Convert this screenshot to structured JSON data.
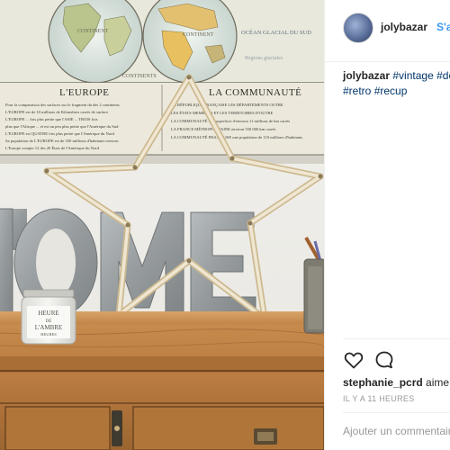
{
  "post": {
    "username": "jolybazar",
    "follow_label": "S'abonner",
    "caption_user": "jolybazar",
    "hashtags": [
      "#vintage",
      "#deco",
      "#retro",
      "#recup"
    ],
    "liker": "stephanie_pcrd",
    "likes_suffix": "aime",
    "timestamp": "IL Y A 11 HEURES",
    "comment_placeholder": "Ajouter un commentaire..."
  },
  "photo": {
    "map_labels": {
      "continent": "CONTINENT",
      "continents": "CONTINENTS",
      "ocean": "OCÉAN GLACIAL DU SUD",
      "regions": "Régions glaciales"
    },
    "poster_left_title": "L'EUROPE",
    "poster_right_title": "LA COMMUNAUTÉ",
    "poster_left_lines": [
      "Pour la comparaison des surfaces sur le fragment du des 2 continents",
      "L'EUROPE est de 10 millions de Kilomètres carrés de surface",
      "L'EUROPE ... fois plus petite que l'ASIE ...  TROIS fois",
      "plus que l'Afrique ... et est un peu plus petite que l'Amérique du Sud",
      "L'EUROPE est QUATRE fois plus petite que l'Amérique du Nord",
      "Sa population de L'EUROPE est de 350 millions d'habitants environ",
      "L'Europe compte 12 des 20 États de l'Amérique du Nord"
    ],
    "poster_right_lines": [
      "LA RÉPUBLIQUE FRANÇAISE LES DÉPARTEMENTS OUTRE",
      "LES ÉTATS MEMBRES ET LES TERRITOIRES D'OUTRE",
      "LA COMMUNAUTÉ  une superficie d'environ 11 millions de km carrés",
      "LA FRANCE MÉTROPOLITAINE  environ 550 000 km carrés",
      "LA COMMUNAUTÉ FRANÇAISE  une population de 110 millions d'habitants"
    ],
    "home_word": "HOME",
    "jar_text": [
      "HEURE",
      "DE",
      "L'AMBRE",
      "HEURES"
    ]
  }
}
